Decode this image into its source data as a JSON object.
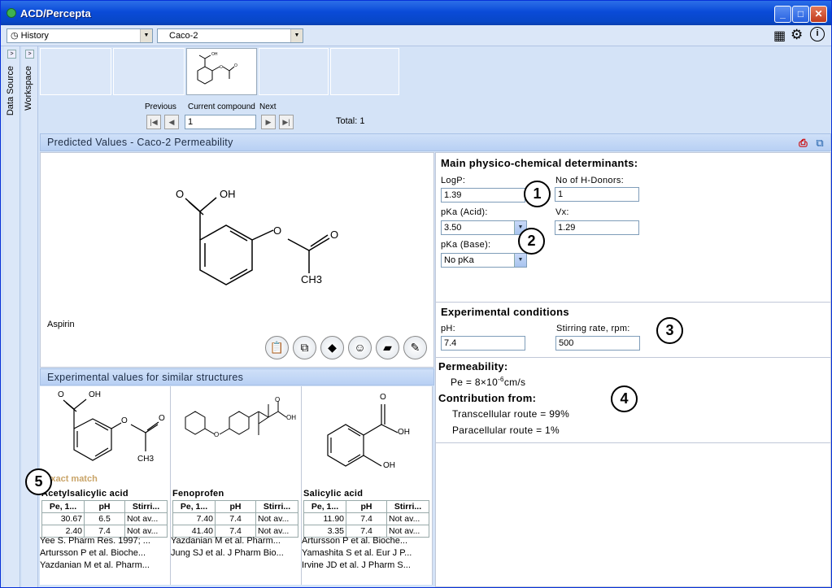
{
  "window": {
    "title": "ACD/Percepta"
  },
  "toolbar": {
    "history_label": "History",
    "module_value": "Caco-2"
  },
  "sidebar": {
    "data_source": "Data Source",
    "workspace": "Workspace"
  },
  "navigation": {
    "previous_label": "Previous",
    "current_label": "Current compound",
    "next_label": "Next",
    "current_value": "1",
    "total_text": "Total: 1"
  },
  "predicted": {
    "header": "Predicted Values - Caco-2 Permeability",
    "compound_name": "Aspirin"
  },
  "determinants": {
    "heading": "Main physico-chemical determinants:",
    "logp_label": "LogP:",
    "logp_value": "1.39",
    "hdonors_label": "No of H-Donors:",
    "hdonors_value": "1",
    "pka_acid_label": "pKa (Acid):",
    "pka_acid_value": "3.50",
    "vx_label": "Vx:",
    "vx_value": "1.29",
    "pka_base_label": "pKa (Base):",
    "pka_base_value": "No pKa"
  },
  "conditions": {
    "heading": "Experimental conditions",
    "ph_label": "pH:",
    "ph_value": "7.4",
    "stirring_label": "Stirring rate, rpm:",
    "stirring_value": "500"
  },
  "permeability": {
    "heading": "Permeability:",
    "pe_prefix": "Pe = 8×10",
    "pe_exp": "-6",
    "pe_unit": "cm/s",
    "contribution_heading": "Contribution from:",
    "transcellular": "Transcellular route = 99%",
    "paracellular": "Paracellular route = 1%"
  },
  "callouts": [
    "1",
    "2",
    "3",
    "4",
    "5"
  ],
  "similar": {
    "header": "Experimental values for similar structures",
    "exact_match": "Exact match",
    "columns": [
      "Pe, 1...",
      "pH",
      "Stirri..."
    ],
    "compounds": [
      {
        "name": "Acetylsalicylic acid",
        "rows": [
          [
            "30.67",
            "6.5",
            "Not av..."
          ],
          [
            "2.40",
            "7.4",
            "Not av..."
          ]
        ],
        "refs": [
          "Yee S. Pharm Res. 1997; ...",
          "Artursson P et al. Bioche...",
          "Yazdanian M et al. Pharm..."
        ]
      },
      {
        "name": "Fenoprofen",
        "rows": [
          [
            "7.40",
            "7.4",
            "Not av..."
          ],
          [
            "41.40",
            "7.4",
            "Not av..."
          ]
        ],
        "refs": [
          "Yazdanian M et al. Pharm...",
          "Jung SJ et al. J Pharm Bio..."
        ]
      },
      {
        "name": "Salicylic acid",
        "rows": [
          [
            "11.90",
            "7.4",
            "Not av..."
          ],
          [
            "3.35",
            "7.4",
            "Not av..."
          ]
        ],
        "refs": [
          "Artursson P et al. Bioche...",
          "Yamashita S et al. Eur J P...",
          "Irvine JD et al. J Pharm S..."
        ]
      }
    ]
  },
  "structure_labels": {
    "oh": "OH",
    "o": "O",
    "ch3": "CH3"
  }
}
